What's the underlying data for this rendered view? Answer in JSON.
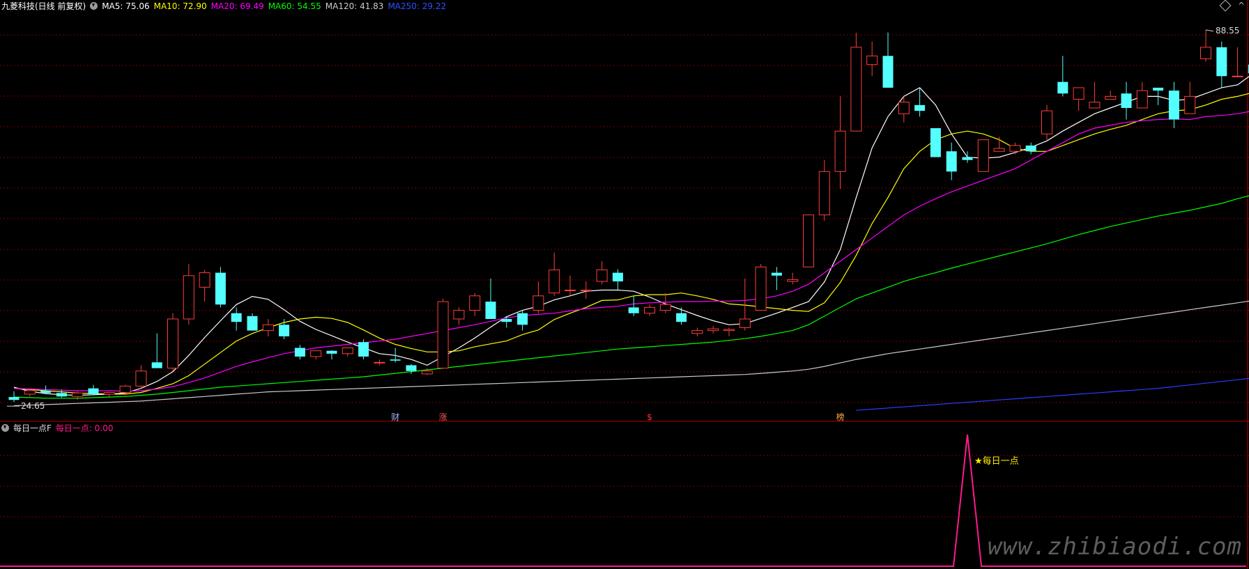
{
  "header": {
    "title": "九菱科技(日线 前复权)",
    "ma": [
      {
        "label": "MA5: 75.06",
        "color": "#ffffff"
      },
      {
        "label": "MA10: 72.90",
        "color": "#ffff00"
      },
      {
        "label": "MA20: 69.49",
        "color": "#ff00ff"
      },
      {
        "label": "MA60: 54.55",
        "color": "#00ff00"
      },
      {
        "label": "MA120: 41.83",
        "color": "#cccccc"
      },
      {
        "label": "MA250: 29.22",
        "color": "#3050ff"
      }
    ]
  },
  "indicator": {
    "name": "每日一点F",
    "value_label": "每日一点: 0.00",
    "signal_label": "★每日一点",
    "color": "#ff1a8c"
  },
  "watermark": "www.zhibiaodi.com",
  "chart_data": {
    "type": "candlestick",
    "max_label": "88.55",
    "min_label": "24.65",
    "ylim": [
      22.5,
      92
    ],
    "grid": true,
    "up_color": "#ff3c3c",
    "down_color": "#54ffff",
    "candles": [
      [
        25.5,
        26.5,
        24.65,
        25.0
      ],
      [
        26.0,
        26.8,
        25.6,
        26.6
      ],
      [
        26.6,
        27.5,
        26.0,
        26.2
      ],
      [
        26.2,
        26.8,
        25.4,
        25.6
      ],
      [
        25.6,
        26.5,
        25.0,
        26.2
      ],
      [
        27.0,
        27.6,
        25.8,
        26.0
      ],
      [
        26.0,
        26.4,
        25.4,
        26.3
      ],
      [
        26.3,
        27.6,
        25.8,
        27.4
      ],
      [
        27.4,
        31.0,
        27.0,
        30.0
      ],
      [
        31.5,
        36.5,
        30.5,
        30.5
      ],
      [
        30.5,
        40.0,
        30.0,
        39.0
      ],
      [
        39.0,
        48.5,
        38.0,
        46.5
      ],
      [
        44.5,
        47.5,
        42.0,
        47.0
      ],
      [
        47.0,
        48.0,
        41.0,
        41.5
      ],
      [
        40.0,
        41.0,
        37.0,
        38.5
      ],
      [
        39.5,
        40.0,
        37.0,
        37.0
      ],
      [
        37.0,
        39.0,
        36.0,
        38.0
      ],
      [
        38.0,
        39.0,
        35.5,
        36.0
      ],
      [
        34.0,
        34.5,
        32.0,
        32.5
      ],
      [
        32.5,
        33.5,
        32.0,
        33.5
      ],
      [
        33.5,
        33.6,
        32.0,
        33.0
      ],
      [
        33.0,
        34.0,
        32.5,
        34.0
      ],
      [
        35.0,
        35.5,
        32.0,
        32.5
      ],
      [
        31.5,
        32.0,
        31.0,
        31.5
      ],
      [
        32.0,
        34.0,
        31.5,
        31.8
      ],
      [
        31.0,
        31.2,
        29.5,
        30.0
      ],
      [
        29.5,
        30.5,
        29.3,
        30.0
      ],
      [
        30.5,
        42.5,
        30.5,
        42.0
      ],
      [
        39.0,
        41.0,
        38.0,
        40.5
      ],
      [
        40.5,
        43.5,
        39.5,
        43.0
      ],
      [
        42.0,
        46.0,
        39.0,
        39.0
      ],
      [
        39.0,
        39.5,
        37.5,
        38.5
      ],
      [
        40.0,
        40.5,
        37.0,
        38.0
      ],
      [
        40.5,
        45.5,
        40.0,
        43.0
      ],
      [
        43.5,
        50.5,
        43.0,
        47.5
      ],
      [
        44.0,
        46.5,
        43.0,
        44.0
      ],
      [
        44.0,
        45.5,
        42.5,
        44.0
      ],
      [
        45.5,
        49.0,
        45.0,
        47.5
      ],
      [
        47.0,
        47.6,
        44.0,
        45.5
      ],
      [
        41.0,
        43.0,
        39.5,
        40.0
      ],
      [
        40.0,
        41.5,
        39.5,
        41.0
      ],
      [
        40.5,
        43.5,
        40.0,
        41.5
      ],
      [
        40.0,
        41.0,
        38.0,
        38.5
      ],
      [
        36.5,
        37.5,
        36.0,
        37.0
      ],
      [
        37.0,
        37.8,
        36.5,
        37.3
      ],
      [
        37.0,
        37.5,
        36.0,
        37.2
      ],
      [
        37.5,
        46.0,
        37.0,
        39.0
      ],
      [
        40.5,
        48.5,
        40.5,
        48.0
      ],
      [
        47.0,
        48.0,
        44.0,
        46.5
      ],
      [
        45.5,
        47.0,
        45.0,
        45.8
      ],
      [
        48.0,
        57.0,
        48.0,
        57.0
      ],
      [
        57.0,
        66.5,
        56.0,
        64.5
      ],
      [
        64.5,
        77.5,
        61.5,
        71.5
      ],
      [
        71.5,
        88.5,
        71.5,
        86.0
      ],
      [
        83.0,
        87.0,
        81.0,
        84.5
      ],
      [
        84.5,
        88.55,
        79.0,
        79.0
      ],
      [
        74.5,
        77.5,
        73.0,
        76.5
      ],
      [
        76.0,
        79.0,
        74.0,
        75.0
      ],
      [
        72.0,
        72.0,
        67.0,
        67.0
      ],
      [
        68.0,
        69.5,
        63.0,
        64.5
      ],
      [
        67.0,
        68.0,
        66.0,
        66.5
      ],
      [
        64.5,
        70.0,
        64.5,
        70.0
      ],
      [
        68.0,
        70.5,
        68.0,
        68.5
      ],
      [
        68.0,
        69.5,
        67.5,
        69.0
      ],
      [
        69.0,
        69.5,
        67.5,
        68.0
      ],
      [
        71.0,
        76.0,
        70.0,
        75.0
      ],
      [
        80.0,
        84.5,
        77.5,
        78.0
      ],
      [
        77.0,
        79.0,
        75.0,
        79.0
      ],
      [
        75.5,
        80.0,
        75.5,
        76.5
      ],
      [
        77.0,
        78.5,
        77.0,
        77.5
      ],
      [
        78.0,
        80.0,
        73.5,
        75.5
      ],
      [
        75.5,
        80.0,
        75.5,
        78.5
      ],
      [
        79.0,
        79.0,
        76.0,
        78.5
      ],
      [
        78.5,
        80.0,
        72.0,
        73.5
      ],
      [
        74.5,
        80.0,
        74.5,
        77.5
      ],
      [
        84.0,
        89.0,
        83.5,
        86.0
      ],
      [
        86.0,
        87.0,
        79.0,
        81.0
      ],
      [
        81.0,
        86.0,
        81.0,
        81.0
      ],
      [
        83.0,
        84.5,
        79.5,
        81.5
      ]
    ],
    "ma_series": [
      {
        "name": "MA5",
        "color": "#ffffff",
        "values": [
          27.2,
          26.5,
          26.1,
          25.9,
          25.8,
          25.9,
          26.0,
          26.2,
          27.0,
          28.2,
          29.9,
          32.7,
          35.8,
          38.7,
          41.5,
          42.9,
          42.4,
          40.6,
          38.6,
          37.2,
          36.1,
          35.0,
          34.0,
          33.0,
          32.7,
          32.0,
          31.0,
          32.5,
          34.0,
          35.7,
          37.6,
          39.4,
          40.5,
          41.2,
          42.3,
          43.0,
          43.8,
          44.0,
          44.0,
          43.8,
          42.8,
          41.6,
          40.6,
          39.6,
          38.7,
          38.0,
          38.2,
          39.1,
          40.0,
          41.0,
          42.0,
          45.4,
          51.0,
          60.0,
          68.6,
          74.0,
          77.5,
          79.0,
          76.0,
          71.0,
          67.0,
          66.8,
          67.0,
          67.8,
          68.7,
          69.8,
          71.5,
          73.0,
          74.5,
          75.5,
          76.5,
          77.5,
          77.5,
          76.8,
          77.0,
          78.0,
          79.0,
          79.5,
          81.5
        ]
      },
      {
        "name": "MA10",
        "color": "#ffff00",
        "values": [
          27.0,
          26.8,
          26.6,
          26.4,
          26.2,
          26.1,
          26.0,
          26.0,
          26.3,
          27.0,
          27.8,
          29.2,
          31.2,
          33.2,
          35.2,
          36.5,
          37.5,
          38.4,
          39.0,
          39.3,
          39.1,
          38.4,
          37.1,
          35.7,
          34.6,
          33.9,
          33.3,
          33.3,
          33.5,
          34.2,
          34.7,
          35.2,
          36.3,
          37.1,
          38.9,
          40.0,
          41.0,
          42.2,
          42.3,
          43.0,
          43.2,
          43.2,
          43.5,
          43.0,
          42.4,
          41.6,
          41.4,
          41.1,
          40.8,
          40.5,
          40.3,
          41.8,
          45.3,
          50.0,
          55.5,
          60.0,
          65.0,
          68.0,
          70.0,
          71.0,
          71.5,
          71.0,
          70.0,
          68.5,
          68.0,
          68.0,
          69.0,
          70.0,
          71.0,
          71.8,
          72.5,
          73.5,
          74.5,
          75.0,
          75.2,
          76.0,
          77.0,
          77.5,
          78.2
        ]
      },
      {
        "name": "MA20",
        "color": "#ff00ff",
        "values": [
          27.0,
          26.9,
          26.8,
          26.7,
          26.6,
          26.6,
          26.6,
          26.5,
          26.6,
          26.9,
          27.3,
          28.0,
          28.8,
          29.8,
          30.8,
          31.6,
          32.3,
          33.0,
          33.5,
          34.0,
          34.3,
          34.6,
          34.9,
          35.2,
          35.5,
          36.0,
          36.5,
          37.0,
          37.5,
          38.0,
          38.6,
          39.2,
          39.6,
          39.8,
          40.0,
          40.4,
          40.8,
          41.0,
          41.2,
          41.6,
          41.8,
          41.9,
          42.0,
          42.0,
          42.1,
          42.1,
          42.2,
          42.5,
          43.0,
          43.8,
          45.0,
          47.0,
          49.0,
          51.0,
          53.0,
          55.0,
          57.0,
          58.5,
          59.8,
          61.0,
          62.0,
          63.0,
          64.0,
          65.0,
          66.5,
          68.0,
          69.5,
          71.0,
          72.0,
          72.5,
          73.0,
          73.3,
          73.5,
          73.6,
          73.5,
          74.0,
          74.2,
          74.5,
          75.0
        ]
      },
      {
        "name": "MA60",
        "color": "#00ff00",
        "values": [
          25.5,
          25.4,
          25.3,
          25.3,
          25.3,
          25.4,
          25.5,
          25.6,
          25.8,
          26.0,
          26.3,
          26.6,
          26.9,
          27.2,
          27.4,
          27.6,
          27.8,
          28.0,
          28.2,
          28.4,
          28.6,
          28.8,
          29.0,
          29.3,
          29.6,
          29.9,
          30.2,
          30.5,
          30.8,
          31.1,
          31.4,
          31.7,
          32.0,
          32.3,
          32.6,
          32.9,
          33.2,
          33.5,
          33.8,
          34.0,
          34.2,
          34.4,
          34.6,
          34.8,
          35.0,
          35.3,
          35.6,
          36.0,
          36.5,
          37.0,
          38.0,
          39.5,
          41.0,
          42.5,
          43.5,
          44.5,
          45.5,
          46.3,
          47.0,
          47.8,
          48.5,
          49.2,
          49.9,
          50.6,
          51.3,
          52.0,
          52.8,
          53.6,
          54.3,
          55.0,
          55.6,
          56.2,
          56.8,
          57.3,
          57.8,
          58.4,
          59.0,
          59.8,
          60.5
        ]
      },
      {
        "name": "MA120",
        "color": "#cccccc",
        "values": [
          24.0,
          24.1,
          24.2,
          24.3,
          24.4,
          24.5,
          24.6,
          24.7,
          24.8,
          25.0,
          25.2,
          25.4,
          25.6,
          25.8,
          26.0,
          26.2,
          26.4,
          26.5,
          26.6,
          26.7,
          26.8,
          26.9,
          27.0,
          27.1,
          27.2,
          27.3,
          27.4,
          27.5,
          27.6,
          27.7,
          27.8,
          27.9,
          28.0,
          28.1,
          28.2,
          28.3,
          28.4,
          28.5,
          28.6,
          28.7,
          28.8,
          28.9,
          29.0,
          29.1,
          29.2,
          29.3,
          29.4,
          29.6,
          29.8,
          30.0,
          30.3,
          30.8,
          31.4,
          32.0,
          32.5,
          33.0,
          33.4,
          33.8,
          34.2,
          34.6,
          35.0,
          35.4,
          35.8,
          36.2,
          36.6,
          37.0,
          37.4,
          37.8,
          38.2,
          38.6,
          39.0,
          39.4,
          39.8,
          40.2,
          40.6,
          41.0,
          41.4,
          41.8,
          42.2
        ]
      },
      {
        "name": "MA250",
        "color": "#2a3cff",
        "start": 53,
        "values": [
          23.2,
          23.4,
          23.6,
          23.8,
          24.0,
          24.2,
          24.4,
          24.6,
          24.8,
          25.0,
          25.2,
          25.4,
          25.6,
          25.8,
          26.0,
          26.2,
          26.4,
          26.6,
          26.8,
          27.0,
          27.3,
          27.6,
          27.9,
          28.2,
          28.5,
          28.8
        ]
      }
    ],
    "markers": [
      {
        "index": 24,
        "text": "财",
        "color": "#aab4ff"
      },
      {
        "index": 27,
        "text": "涨",
        "color": "#ff5555"
      },
      {
        "index": 40,
        "text": "$",
        "color": "#ff3333"
      },
      {
        "index": 52,
        "text": "榜",
        "color": "#ffaa44"
      }
    ],
    "indicator_series": {
      "signal_index": 60,
      "peak": 1.0
    }
  }
}
